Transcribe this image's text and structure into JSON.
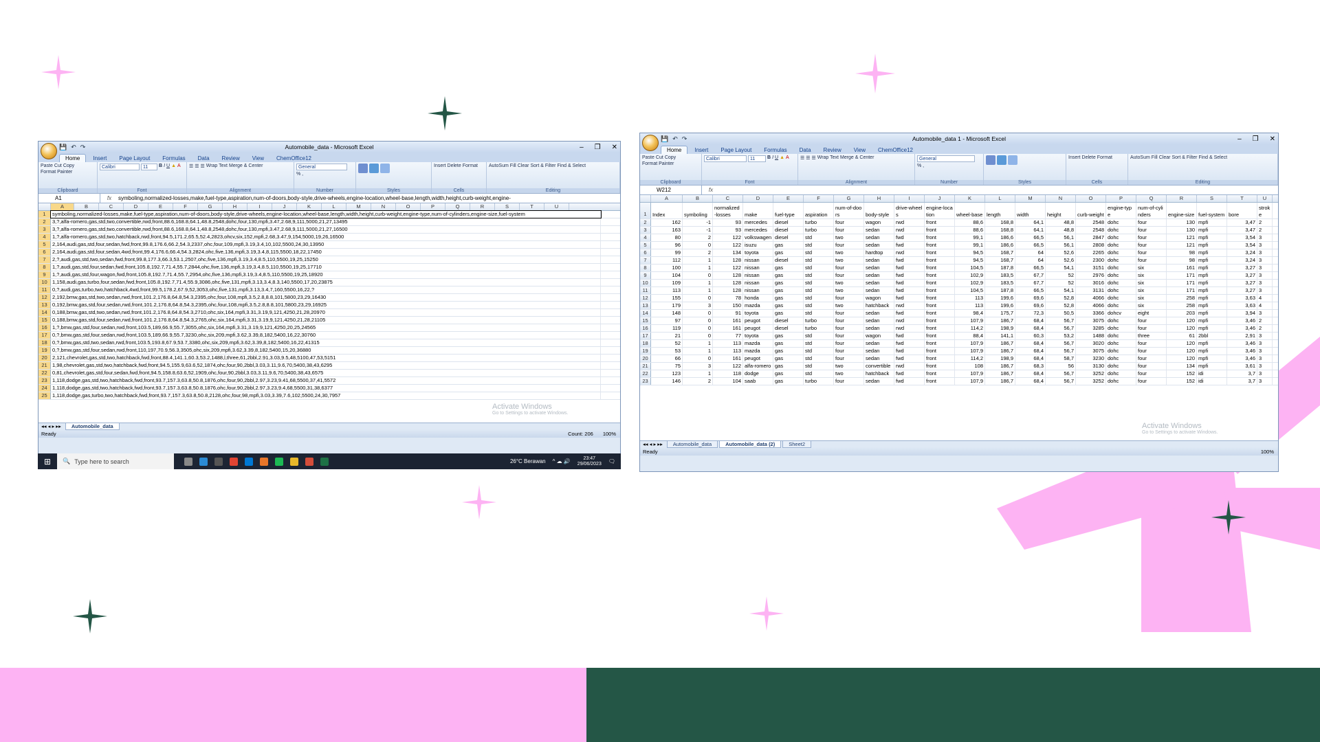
{
  "win1": {
    "title": "Automobile_data - Microsoft Excel",
    "tabs": [
      "Home",
      "Insert",
      "Page Layout",
      "Formulas",
      "Data",
      "Review",
      "View",
      "ChemOffice12"
    ],
    "clipboard": {
      "paste": "Paste",
      "cut": "Cut",
      "copy": "Copy",
      "format_painter": "Format Painter",
      "label": "Clipboard"
    },
    "font": {
      "name": "Calibri",
      "size": "11",
      "label": "Font"
    },
    "alignment": {
      "wrap": "Wrap Text",
      "merge": "Merge & Center",
      "label": "Alignment"
    },
    "number": {
      "format": "General",
      "label": "Number"
    },
    "styles": {
      "cond": "Conditional Formatting",
      "table": "Format as Table",
      "cell": "Cell Styles",
      "label": "Styles"
    },
    "cells": {
      "insert": "Insert",
      "delete": "Delete",
      "format": "Format",
      "label": "Cells"
    },
    "editing": {
      "autosum": "AutoSum",
      "fill": "Fill",
      "clear": "Clear",
      "sort": "Sort & Filter",
      "find": "Find & Select",
      "label": "Editing"
    },
    "namebox": "A1",
    "fx": "fx",
    "formula": "symboling,normalized-losses,make,fuel-type,aspiration,num-of-doors,body-style,drive-wheels,engine-location,wheel-base,length,width,height,curb-weight,engine-",
    "columns": [
      "A",
      "B",
      "C",
      "D",
      "E",
      "F",
      "G",
      "H",
      "I",
      "J",
      "K",
      "L",
      "M",
      "N",
      "O",
      "P",
      "Q",
      "R",
      "S",
      "T",
      "U"
    ],
    "rows": [
      "symboling,normalized-losses,make,fuel-type,aspiration,num-of-doors,body-style,drive-wheels,engine-location,wheel-base,length,width,height,curb-weight,engine-type,num-of-cylinders,engine-size,fuel-system",
      "3,?,alfa-romero,gas,std,two,convertible,rwd,front,88.6,168.8,64.1,48.8,2548,dohc,four,130,mpfi,3.47,2.68,9,111,5000,21,27,13495",
      "3,?,alfa-romero,gas,std,two,convertible,rwd,front,88.6,168.8,64.1,48.8,2548,dohc,four,130,mpfi,3.47,2.68,9,111,5000,21,27,16500",
      "1,?,alfa-romero,gas,std,two,hatchback,rwd,front,94.5,171.2,65.5,52.4,2823,ohcv,six,152,mpfi,2.68,3.47,9,154,5000,19,26,16500",
      "2,164,audi,gas,std,four,sedan,fwd,front,99.8,176.6,66.2,54.3,2337,ohc,four,109,mpfi,3.19,3.4,10,102,5500,24,30,13950",
      "2,164,audi,gas,std,four,sedan,4wd,front,99.4,176.6,66.4,54.3,2824,ohc,five,136,mpfi,3.19,3.4,8,115,5500,18,22,17450",
      "2,?,audi,gas,std,two,sedan,fwd,front,99.8,177.3,66.3,53.1,2507,ohc,five,136,mpfi,3.19,3.4,8.5,110,5500,19,25,15250",
      "1,?,audi,gas,std,four,sedan,fwd,front,105.8,192.7,71.4,55.7,2844,ohc,five,136,mpfi,3.19,3.4,8.5,110,5500,19,25,17710",
      "1,?,audi,gas,std,four,wagon,fwd,front,105.8,192.7,71.4,55.7,2954,ohc,five,136,mpfi,3.19,3.4,8.5,110,5500,19,25,18920",
      "1,158,audi,gas,turbo,four,sedan,fwd,front,105.8,192.7,71.4,55.9,3086,ohc,five,131,mpfi,3.13,3.4,8.3,140,5500,17,20,23875",
      "0,?,audi,gas,turbo,two,hatchback,4wd,front,99.5,178.2,67.9,52,3053,ohc,five,131,mpfi,3.13,3.4,7,160,5500,16,22,?",
      "2,192,bmw,gas,std,two,sedan,rwd,front,101.2,176.8,64.8,54.3,2395,ohc,four,108,mpfi,3.5,2.8,8.8,101,5800,23,29,16430",
      "0,192,bmw,gas,std,four,sedan,rwd,front,101.2,176.8,64.8,54.3,2395,ohc,four,108,mpfi,3.5,2.8,8.8,101,5800,23,29,16925",
      "0,188,bmw,gas,std,two,sedan,rwd,front,101.2,176.8,64.8,54.3,2710,ohc,six,164,mpfi,3.31,3.19,9,121,4250,21,28,20970",
      "0,188,bmw,gas,std,four,sedan,rwd,front,101.2,176.8,64.8,54.3,2765,ohc,six,164,mpfi,3.31,3.19,9,121,4250,21,28,21105",
      "1,?,bmw,gas,std,four,sedan,rwd,front,103.5,189,66.9,55.7,3055,ohc,six,164,mpfi,3.31,3.19,9,121,4250,20,25,24565",
      "0,?,bmw,gas,std,four,sedan,rwd,front,103.5,189,66.9,55.7,3230,ohc,six,209,mpfi,3.62,3.39,8,182,5400,16,22,30760",
      "0,?,bmw,gas,std,two,sedan,rwd,front,103.5,193.8,67.9,53.7,3380,ohc,six,209,mpfi,3.62,3.39,8,182,5400,16,22,41315",
      "0,?,bmw,gas,std,four,sedan,rwd,front,110,197,70.9,56.3,3505,ohc,six,209,mpfi,3.62,3.39,8,182,5400,15,20,36880",
      "2,121,chevrolet,gas,std,two,hatchback,fwd,front,88.4,141.1,60.3,53.2,1488,l,three,61,2bbl,2.91,3.03,9.5,48,5100,47,53,5151",
      "1,98,chevrolet,gas,std,two,hatchback,fwd,front,94.5,155.9,63.6,52,1874,ohc,four,90,2bbl,3.03,3.11,9.6,70,5400,38,43,6295",
      "0,81,chevrolet,gas,std,four,sedan,fwd,front,94.5,158.8,63.6,52,1909,ohc,four,90,2bbl,3.03,3.11,9.6,70,5400,38,43,6575",
      "1,118,dodge,gas,std,two,hatchback,fwd,front,93.7,157.3,63.8,50.8,1876,ohc,four,90,2bbl,2.97,3.23,9.41,68,5500,37,41,5572",
      "1,118,dodge,gas,std,two,hatchback,fwd,front,93.7,157.3,63.8,50.8,1876,ohc,four,90,2bbl,2.97,3.23,9.4,68,5500,31,38,6377",
      "1,118,dodge,gas,turbo,two,hatchback,fwd,front,93.7,157.3,63.8,50.8,2128,ohc,four,98,mpfi,3.03,3.39,7.6,102,5500,24,30,7957"
    ],
    "sheets": [
      "Automobile_data"
    ],
    "status_left": "Ready",
    "status_count": "Count: 206",
    "zoom": "100%",
    "watermark_title": "Activate Windows",
    "watermark_sub": "Go to Settings to activate Windows."
  },
  "taskbar": {
    "search_placeholder": "Type here to search",
    "weather": "26°C  Berawan",
    "time": "23:47",
    "date": "29/06/2023"
  },
  "win2": {
    "title": "Automobile_data 1 - Microsoft Excel",
    "tabs": [
      "Home",
      "Insert",
      "Page Layout",
      "Formulas",
      "Data",
      "Review",
      "View",
      "ChemOffice12"
    ],
    "clipboard": {
      "paste": "Paste",
      "cut": "Cut",
      "copy": "Copy",
      "format_painter": "Format Painter",
      "label": "Clipboard"
    },
    "font": {
      "name": "Calibri",
      "size": "11",
      "label": "Font"
    },
    "alignment": {
      "wrap": "Wrap Text",
      "merge": "Merge & Center",
      "label": "Alignment"
    },
    "number": {
      "format": "General",
      "label": "Number"
    },
    "styles": {
      "cond": "Conditional Formatting",
      "table": "Format as Table",
      "cell": "Cell Styles",
      "label": "Styles"
    },
    "cells": {
      "insert": "Insert",
      "delete": "Delete",
      "format": "Format",
      "label": "Cells"
    },
    "editing": {
      "autosum": "AutoSum",
      "fill": "Fill",
      "clear": "Clear",
      "sort": "Sort & Filter",
      "find": "Find & Select",
      "label": "Editing"
    },
    "namebox": "W212",
    "fx": "fx",
    "columns": [
      "A",
      "B",
      "C",
      "D",
      "E",
      "F",
      "G",
      "H",
      "I",
      "J",
      "K",
      "L",
      "M",
      "N",
      "O",
      "P",
      "Q",
      "R",
      "S",
      "T",
      "U"
    ],
    "header": [
      "Index",
      "symboling",
      "normalized-losses",
      "make",
      "fuel-type",
      "aspiration",
      "num-of-doors",
      "body-style",
      "drive-wheels",
      "engine-location",
      "wheel-base",
      "length",
      "width",
      "height",
      "curb-weight",
      "engine-type",
      "num-of-cylinders",
      "engine-size",
      "fuel-system",
      "bore",
      "stroke"
    ],
    "rows": [
      [
        "162",
        "-1",
        "93",
        "mercedes",
        "diesel",
        "turbo",
        "four",
        "wagon",
        "rwd",
        "front",
        "88,6",
        "168,8",
        "64,1",
        "48,8",
        "2548",
        "dohc",
        "four",
        "130",
        "mpfi",
        "3,47",
        "2"
      ],
      [
        "163",
        "-1",
        "93",
        "mercedes",
        "diesel",
        "turbo",
        "four",
        "sedan",
        "rwd",
        "front",
        "88,6",
        "168,8",
        "64,1",
        "48,8",
        "2548",
        "dohc",
        "four",
        "130",
        "mpfi",
        "3,47",
        "2"
      ],
      [
        "80",
        "2",
        "122",
        "volkswagen",
        "diesel",
        "std",
        "two",
        "sedan",
        "fwd",
        "front",
        "99,1",
        "186,6",
        "66,5",
        "56,1",
        "2847",
        "dohc",
        "four",
        "121",
        "mpfi",
        "3,54",
        "3"
      ],
      [
        "96",
        "0",
        "122",
        "isuzu",
        "gas",
        "std",
        "four",
        "sedan",
        "fwd",
        "front",
        "99,1",
        "186,6",
        "66,5",
        "56,1",
        "2808",
        "dohc",
        "four",
        "121",
        "mpfi",
        "3,54",
        "3"
      ],
      [
        "99",
        "2",
        "134",
        "toyota",
        "gas",
        "std",
        "two",
        "hardtop",
        "rwd",
        "front",
        "94,5",
        "168,7",
        "64",
        "52,6",
        "2265",
        "dohc",
        "four",
        "98",
        "mpfi",
        "3,24",
        "3"
      ],
      [
        "112",
        "1",
        "128",
        "nissan",
        "diesel",
        "std",
        "two",
        "sedan",
        "fwd",
        "front",
        "94,5",
        "168,7",
        "64",
        "52,6",
        "2300",
        "dohc",
        "four",
        "98",
        "mpfi",
        "3,24",
        "3"
      ],
      [
        "100",
        "1",
        "122",
        "nissan",
        "gas",
        "std",
        "four",
        "sedan",
        "fwd",
        "front",
        "104,5",
        "187,8",
        "66,5",
        "54,1",
        "3151",
        "dohc",
        "six",
        "161",
        "mpfi",
        "3,27",
        "3"
      ],
      [
        "104",
        "0",
        "128",
        "nissan",
        "gas",
        "std",
        "four",
        "sedan",
        "fwd",
        "front",
        "102,9",
        "183,5",
        "67,7",
        "52",
        "2976",
        "dohc",
        "six",
        "171",
        "mpfi",
        "3,27",
        "3"
      ],
      [
        "109",
        "1",
        "128",
        "nissan",
        "gas",
        "std",
        "two",
        "sedan",
        "fwd",
        "front",
        "102,9",
        "183,5",
        "67,7",
        "52",
        "3016",
        "dohc",
        "six",
        "171",
        "mpfi",
        "3,27",
        "3"
      ],
      [
        "113",
        "1",
        "128",
        "nissan",
        "gas",
        "std",
        "two",
        "sedan",
        "fwd",
        "front",
        "104,5",
        "187,8",
        "66,5",
        "54,1",
        "3131",
        "dohc",
        "six",
        "171",
        "mpfi",
        "3,27",
        "3"
      ],
      [
        "155",
        "0",
        "78",
        "honda",
        "gas",
        "std",
        "four",
        "wagon",
        "fwd",
        "front",
        "113",
        "199,6",
        "69,6",
        "52,8",
        "4066",
        "dohc",
        "six",
        "258",
        "mpfi",
        "3,63",
        "4"
      ],
      [
        "179",
        "3",
        "150",
        "mazda",
        "gas",
        "std",
        "two",
        "hatchback",
        "rwd",
        "front",
        "113",
        "199,6",
        "69,6",
        "52,8",
        "4066",
        "dohc",
        "six",
        "258",
        "mpfi",
        "3,63",
        "4"
      ],
      [
        "148",
        "0",
        "91",
        "toyota",
        "gas",
        "std",
        "four",
        "sedan",
        "fwd",
        "front",
        "98,4",
        "175,7",
        "72,3",
        "50,5",
        "3366",
        "dohcv",
        "eight",
        "203",
        "mpfi",
        "3,94",
        "3"
      ],
      [
        "97",
        "0",
        "161",
        "peugot",
        "diesel",
        "turbo",
        "four",
        "sedan",
        "rwd",
        "front",
        "107,9",
        "186,7",
        "68,4",
        "56,7",
        "3075",
        "dohc",
        "four",
        "120",
        "mpfi",
        "3,46",
        "2"
      ],
      [
        "119",
        "0",
        "161",
        "peugot",
        "diesel",
        "turbo",
        "four",
        "sedan",
        "rwd",
        "front",
        "114,2",
        "198,9",
        "68,4",
        "56,7",
        "3285",
        "dohc",
        "four",
        "120",
        "mpfi",
        "3,46",
        "2"
      ],
      [
        "21",
        "0",
        "77",
        "toyota",
        "gas",
        "std",
        "four",
        "wagon",
        "fwd",
        "front",
        "88,4",
        "141,1",
        "60,3",
        "53,2",
        "1488",
        "dohc",
        "three",
        "61",
        "2bbl",
        "2,91",
        "3"
      ],
      [
        "52",
        "1",
        "113",
        "mazda",
        "gas",
        "std",
        "four",
        "sedan",
        "fwd",
        "front",
        "107,9",
        "186,7",
        "68,4",
        "56,7",
        "3020",
        "dohc",
        "four",
        "120",
        "mpfi",
        "3,46",
        "3"
      ],
      [
        "53",
        "1",
        "113",
        "mazda",
        "gas",
        "std",
        "four",
        "sedan",
        "fwd",
        "front",
        "107,9",
        "186,7",
        "68,4",
        "56,7",
        "3075",
        "dohc",
        "four",
        "120",
        "mpfi",
        "3,46",
        "3"
      ],
      [
        "66",
        "0",
        "161",
        "peugot",
        "gas",
        "std",
        "four",
        "sedan",
        "fwd",
        "front",
        "114,2",
        "198,9",
        "68,4",
        "58,7",
        "3230",
        "dohc",
        "four",
        "120",
        "mpfi",
        "3,46",
        "3"
      ],
      [
        "75",
        "3",
        "122",
        "alfa-romero",
        "gas",
        "std",
        "two",
        "convertible",
        "rwd",
        "front",
        "108",
        "186,7",
        "68,3",
        "56",
        "3130",
        "dohc",
        "four",
        "134",
        "mpfi",
        "3,61",
        "3"
      ],
      [
        "123",
        "1",
        "118",
        "dodge",
        "gas",
        "std",
        "two",
        "hatchback",
        "fwd",
        "front",
        "107,9",
        "186,7",
        "68,4",
        "56,7",
        "3252",
        "dohc",
        "four",
        "152",
        "idi",
        "3,7",
        "3"
      ],
      [
        "146",
        "2",
        "104",
        "saab",
        "gas",
        "turbo",
        "four",
        "sedan",
        "fwd",
        "front",
        "107,9",
        "186,7",
        "68,4",
        "56,7",
        "3252",
        "dohc",
        "four",
        "152",
        "idi",
        "3,7",
        "3"
      ]
    ],
    "sheets": [
      "Automobile_data",
      "Automobile_data (2)",
      "Sheet2"
    ],
    "status_left": "Ready",
    "zoom": "100%",
    "watermark_title": "Activate Windows",
    "watermark_sub": "Go to Settings to activate Windows."
  },
  "colors": {
    "pink": "#fdb3f3",
    "green": "#245646",
    "excel_blue": "#dfe9f5"
  }
}
